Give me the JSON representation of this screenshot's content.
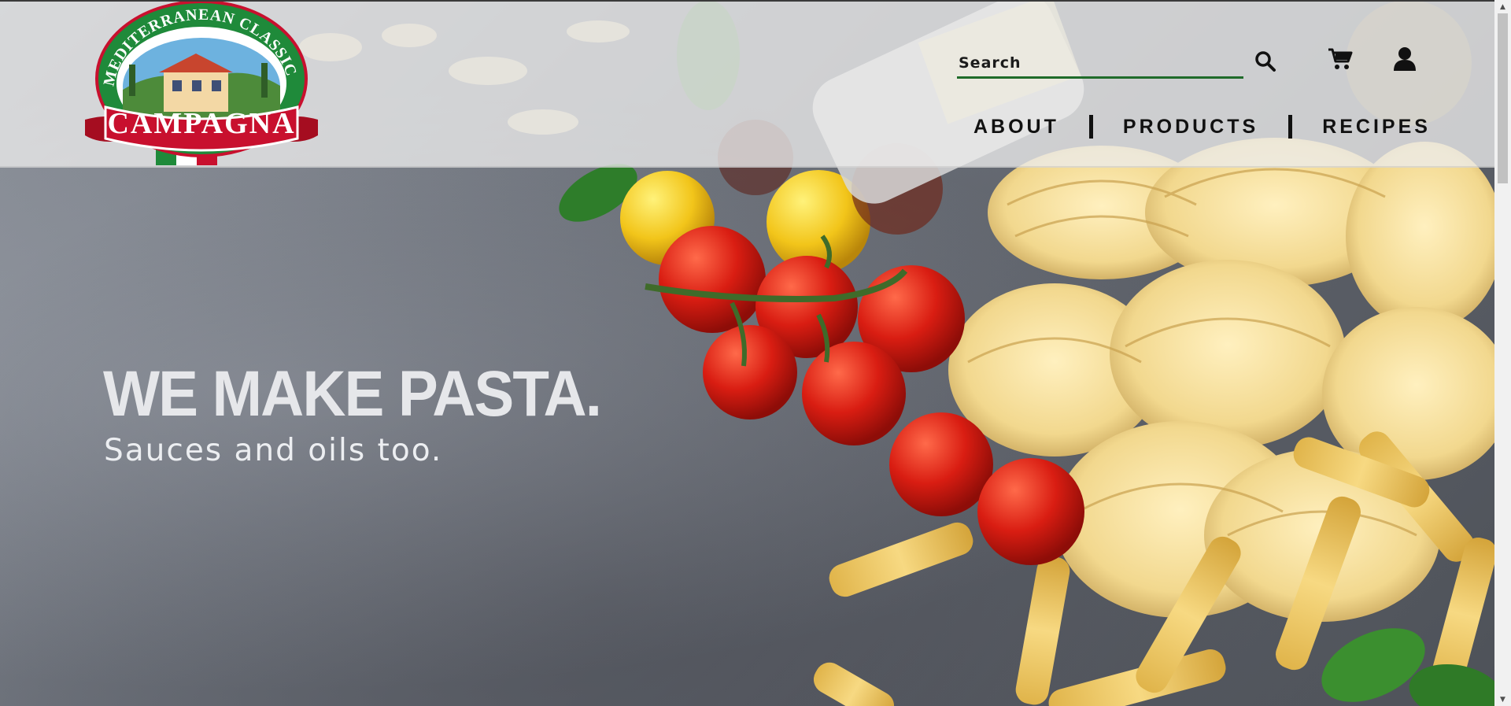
{
  "brand": {
    "arc_text": "MEDITERRANEAN CLASSICS",
    "banner_text": "CAMPAGNA"
  },
  "search": {
    "placeholder": "Search",
    "value": ""
  },
  "icons": {
    "search": "search-icon",
    "cart": "cart-icon",
    "account": "user-icon"
  },
  "nav": {
    "items": [
      {
        "label": "ABOUT"
      },
      {
        "label": "PRODUCTS"
      },
      {
        "label": "RECIPES"
      }
    ]
  },
  "hero": {
    "title": "WE MAKE PASTA.",
    "subtitle": "Sauces and oils too."
  },
  "colors": {
    "accent_green": "#1f6b2a",
    "brand_red": "#c8102e",
    "header_overlay": "#ececec",
    "hero_text": "#e6e7ea"
  }
}
